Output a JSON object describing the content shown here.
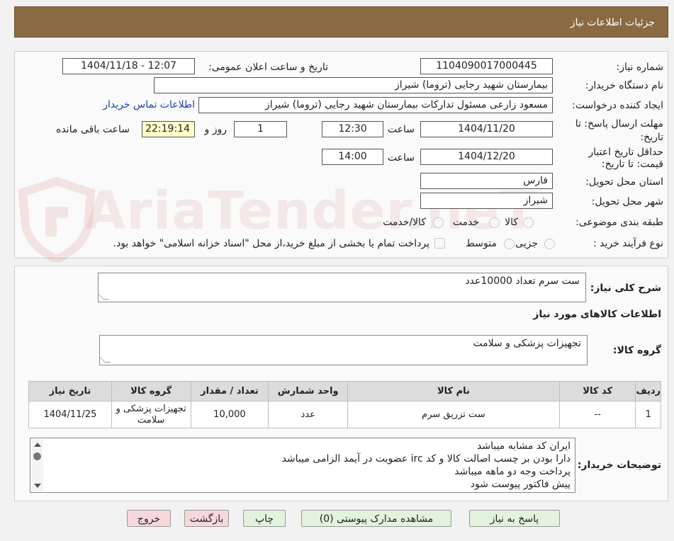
{
  "header": {
    "title": "جزئیات اطلاعات نیاز"
  },
  "watermark": {
    "text": "AriaTender.neT"
  },
  "form": {
    "need_number_label": "شماره نیاز:",
    "need_number": "1104090017000445",
    "announce_label": "تاریخ و ساعت اعلان عمومی:",
    "announce_value": "1404/11/18 - 12:07",
    "buyer_org_label": "نام دستگاه خریدار:",
    "buyer_org": "بیمارستان شهید رجایی (تروما) شیراز",
    "requester_label": "ایجاد کننده درخواست:",
    "requester": "مسعود زارعی مسئول تدارکات بیمارستان شهید رجایی (تروما) شیراز",
    "contact_link": "اطلاعات تماس خریدار",
    "deadline_label": "مهلت ارسال پاسخ: تا تاریخ:",
    "deadline_date": "1404/11/20",
    "time_label": "ساعت",
    "deadline_time": "12:30",
    "days_value": "1",
    "days_label": "روز و",
    "remaining_time": "22:19:14",
    "remaining_label": "ساعت باقی مانده",
    "validity_label": "حداقل تاریخ اعتبار قیمت: تا تاریخ:",
    "validity_date": "1404/12/20",
    "validity_time": "14:00",
    "province_label": "استان محل تحویل:",
    "province": "فارس",
    "city_label": "شهر محل تحویل:",
    "city": "شیراز",
    "category_label": "طبقه بندی موضوعی:",
    "category_options": [
      "کالا",
      "خدمت",
      "کالا/خدمت"
    ],
    "process_label": "نوع فرآیند خرید :",
    "process_options": [
      "جزیی",
      "متوسط"
    ],
    "payment_note": "پرداخت تمام یا بخشی از مبلغ خرید،از محل \"اسناد خزانه اسلامی\" خواهد بود."
  },
  "summary": {
    "label": "شرح کلی نیاز:",
    "value": "ست سرم تعداد 10000عدد",
    "goods_info_title": "اطلاعات کالاهای مورد نیاز",
    "group_label": "گروه کالا:",
    "group_value": "تجهیزات پزشکی و سلامت"
  },
  "table": {
    "headers": [
      "ردیف",
      "کد کالا",
      "نام کالا",
      "واحد شمارش",
      "تعداد / مقدار",
      "گروه کالا",
      "تاریخ نیاز"
    ],
    "rows": [
      [
        "1",
        "--",
        "ست تزریق سرم",
        "عدد",
        "10,000",
        "تجهیزات پزشکی و سلامت",
        "1404/11/25"
      ]
    ]
  },
  "notes": {
    "label": "توضیحات خریدار:",
    "lines": [
      "ایران کد مشابه میباشد",
      "دارا بودن بر چسب اصالت کالا و کد irc عضویت در آیمد الزامی میباشد",
      "پرداخت وجه دو ماهه میباشد",
      "پیش فاکتور پیوست شود"
    ]
  },
  "buttons": {
    "reply": "پاسخ به نیاز",
    "attachments": "مشاهده مدارک پیوستی (0)",
    "print": "چاپ",
    "back": "بازگشت",
    "exit": "خروج"
  },
  "colors": {
    "header_bg": "#8a6a42",
    "link": "#1a3fb0",
    "remaining_bg": "#ffffcc",
    "button_green": "#e2f2dc",
    "button_pink": "#f6d8dc"
  }
}
